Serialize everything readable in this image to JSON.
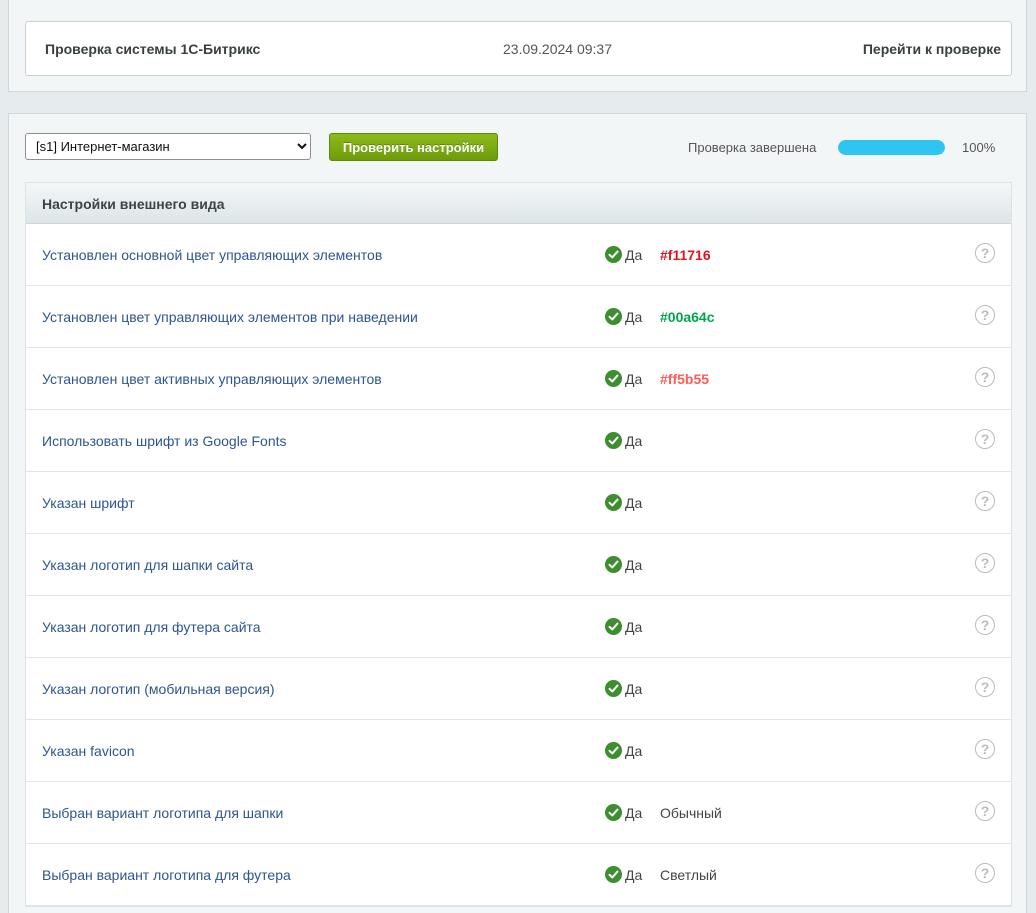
{
  "header": {
    "title": "Проверка системы 1С-Битрикс",
    "datetime": "23.09.2024 09:37",
    "goto_link": "Перейти к проверке"
  },
  "toolbar": {
    "site_select_value": "[s1] Интернет-магазин",
    "check_button": "Проверить настройки",
    "status_text": "Проверка завершена",
    "progress_percent": 100,
    "progress_label": "100%"
  },
  "section": {
    "title": "Настройки внешнего вида"
  },
  "rows": [
    {
      "label": "Установлен основной цвет управляющих элементов",
      "status": "Да",
      "value": "#f11716",
      "value_color": "#e0161f"
    },
    {
      "label": "Установлен цвет управляющих элементов при наведении",
      "status": "Да",
      "value": "#00a64c",
      "value_color": "#00a64c"
    },
    {
      "label": "Установлен цвет активных управляющих элементов",
      "status": "Да",
      "value": "#ff5b55",
      "value_color": "#ff5b55"
    },
    {
      "label": "Использовать шрифт из Google Fonts",
      "status": "Да",
      "value": "",
      "value_color": ""
    },
    {
      "label": "Указан шрифт",
      "status": "Да",
      "value": "",
      "value_color": ""
    },
    {
      "label": "Указан логотип для шапки сайта",
      "status": "Да",
      "value": "",
      "value_color": ""
    },
    {
      "label": "Указан логотип для футера сайта",
      "status": "Да",
      "value": "",
      "value_color": ""
    },
    {
      "label": "Указан логотип (мобильная версия)",
      "status": "Да",
      "value": "",
      "value_color": ""
    },
    {
      "label": "Указан favicon",
      "status": "Да",
      "value": "",
      "value_color": ""
    },
    {
      "label": "Выбран вариант логотипа для шапки",
      "status": "Да",
      "value": "Обычный",
      "value_color": ""
    },
    {
      "label": "Выбран вариант логотипа для футера",
      "status": "Да",
      "value": "Светлый",
      "value_color": ""
    }
  ],
  "colors": {
    "accent_green": "#6e9b0a",
    "progress_blue": "#2ec5f3",
    "check_green": "#3d8e2f",
    "link_blue": "#2d5592"
  },
  "icons": {
    "status_icon": "check-circle-icon",
    "help_icon": "question-circle-icon",
    "help_glyph": "?"
  }
}
